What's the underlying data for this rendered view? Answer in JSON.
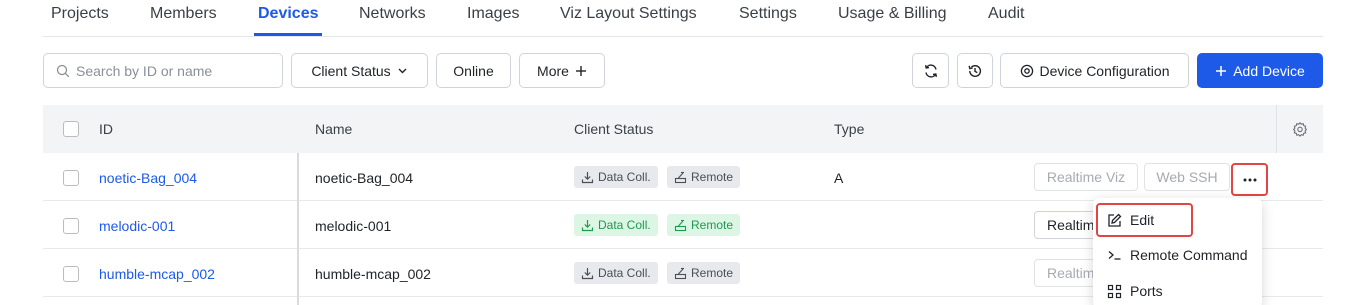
{
  "tabs": [
    {
      "label": "Projects"
    },
    {
      "label": "Members"
    },
    {
      "label": "Devices"
    },
    {
      "label": "Networks"
    },
    {
      "label": "Images"
    },
    {
      "label": "Viz Layout Settings"
    },
    {
      "label": "Settings"
    },
    {
      "label": "Usage & Billing"
    },
    {
      "label": "Audit"
    }
  ],
  "active_tab": "Devices",
  "toolbar": {
    "search_placeholder": "Search by ID or name",
    "client_status_label": "Client Status",
    "online_label": "Online",
    "more_label": "More",
    "device_config_label": "Device Configuration",
    "add_device_label": "Add Device"
  },
  "table": {
    "columns": [
      "ID",
      "Name",
      "Client Status",
      "Type"
    ],
    "rows": [
      {
        "id": "noetic-Bag_004",
        "name": "noetic-Bag_004",
        "tag1": "Data Coll.",
        "tag2": "Remote",
        "status_color": "gray",
        "type": "A",
        "action1": "Realtime Viz",
        "action2": "Web SSH"
      },
      {
        "id": "melodic-001",
        "name": "melodic-001",
        "tag1": "Data Coll.",
        "tag2": "Remote",
        "status_color": "green",
        "type": "",
        "action1": "Realtim",
        "action2": ""
      },
      {
        "id": "humble-mcap_002",
        "name": "humble-mcap_002",
        "tag1": "Data Coll.",
        "tag2": "Remote",
        "status_color": "gray",
        "type": "",
        "action1": "Realtim",
        "action2": ""
      }
    ]
  },
  "menu": {
    "items": [
      {
        "label": "Edit",
        "icon": "edit-icon"
      },
      {
        "label": "Remote Command",
        "icon": "terminal-icon"
      },
      {
        "label": "Ports",
        "icon": "ports-icon"
      }
    ]
  },
  "colors": {
    "accent": "#1d5ae8",
    "highlight_box": "#e04646",
    "tag_green_bg": "#dcf5e4",
    "tag_gray_bg": "#e8e9ed"
  }
}
